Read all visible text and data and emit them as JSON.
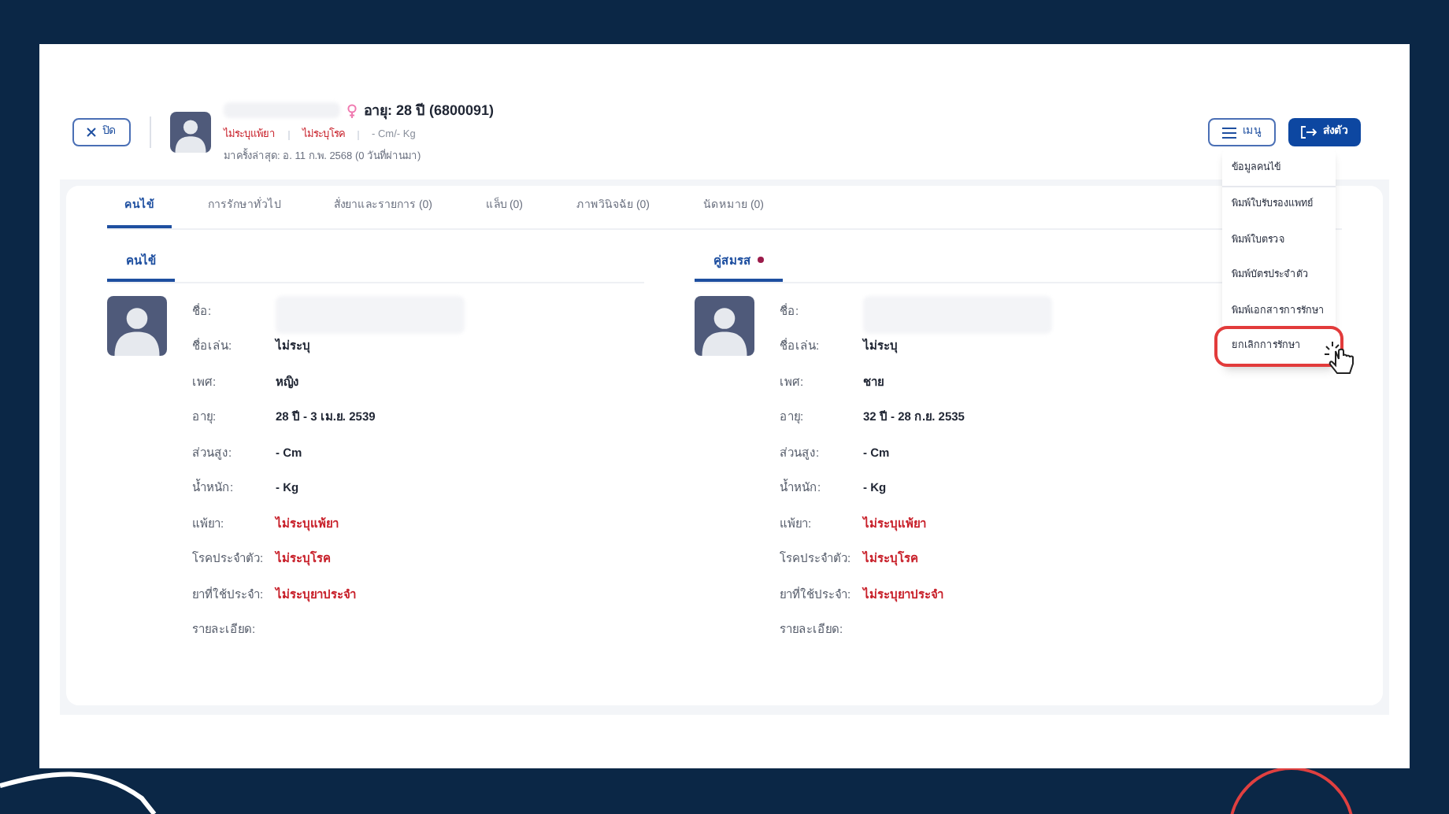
{
  "header": {
    "close_label": "ปิด",
    "age_line": "อายุ: 28 ปี (6800091)",
    "allergy": "ไม่ระบุแพ้ยา",
    "disease": "ไม่ระบุโรค",
    "measure": "- Cm/- Kg",
    "last_visit": "มาครั้งล่าสุด: อ. 11 ก.พ. 2568 (0 วันที่ผ่านมา)",
    "menu_label": "เมนู",
    "refer_label": "ส่งตัว"
  },
  "menu": [
    {
      "label": "ข้อมูลคนไข้",
      "selected": false
    },
    {
      "label": "พิมพ์ใบรับรองแพทย์",
      "selected": false
    },
    {
      "label": "พิมพ์ใบตรวจ",
      "selected": false
    },
    {
      "label": "พิมพ์บัตรประจำตัว",
      "selected": false
    },
    {
      "label": "พิมพ์เอกสารการรักษา",
      "selected": false
    },
    {
      "label": "ยกเลิกการรักษา",
      "selected": true
    }
  ],
  "tabs": [
    {
      "label": "คนไข้",
      "selected": true
    },
    {
      "label": "การรักษาทั่วไป",
      "selected": false
    },
    {
      "label": "สั่งยาและรายการ (0)",
      "selected": false
    },
    {
      "label": "แล็บ (0)",
      "selected": false
    },
    {
      "label": "ภาพวินิจฉัย (0)",
      "selected": false
    },
    {
      "label": "นัดหมาย (0)",
      "selected": false
    }
  ],
  "sections": [
    {
      "title": "คนไข้",
      "indicator": false,
      "fields": [
        {
          "label": "ชื่อ:",
          "kind": "redacted"
        },
        {
          "label": "ชื่อเล่น:",
          "kind": "normal",
          "value": "ไม่ระบุ"
        },
        {
          "label": "เพศ:",
          "kind": "normal",
          "value": "หญิง"
        },
        {
          "label": "อายุ:",
          "kind": "normal",
          "value": "28 ปี - 3 เม.ย. 2539"
        },
        {
          "label": "ส่วนสูง:",
          "kind": "normal",
          "value": "- Cm"
        },
        {
          "label": "น้ำหนัก:",
          "kind": "normal",
          "value": "- Kg"
        },
        {
          "label": "แพ้ยา:",
          "kind": "alert",
          "value": "ไม่ระบุแพ้ยา"
        },
        {
          "label": "โรคประจำตัว:",
          "kind": "alert",
          "value": "ไม่ระบุโรค"
        },
        {
          "label": "ยาที่ใช้ประจำ:",
          "kind": "alert",
          "value": "ไม่ระบุยาประจำ"
        },
        {
          "label": "รายละเอียด:",
          "kind": "normal"
        }
      ]
    },
    {
      "title": "คู่สมรส",
      "indicator": true,
      "fields": [
        {
          "label": "ชื่อ:",
          "kind": "redacted"
        },
        {
          "label": "ชื่อเล่น:",
          "kind": "normal",
          "value": "ไม่ระบุ"
        },
        {
          "label": "เพศ:",
          "kind": "normal",
          "value": "ชาย"
        },
        {
          "label": "อายุ:",
          "kind": "normal",
          "value": "32 ปี - 28 ก.ย. 2535"
        },
        {
          "label": "ส่วนสูง:",
          "kind": "normal",
          "value": "- Cm"
        },
        {
          "label": "น้ำหนัก:",
          "kind": "normal",
          "value": "- Kg"
        },
        {
          "label": "แพ้ยา:",
          "kind": "alert",
          "value": "ไม่ระบุแพ้ยา"
        },
        {
          "label": "โรคประจำตัว:",
          "kind": "alert",
          "value": "ไม่ระบุโรค"
        },
        {
          "label": "ยาที่ใช้ประจำ:",
          "kind": "alert",
          "value": "ไม่ระบุยาประจำ"
        },
        {
          "label": "รายละเอียด:",
          "kind": "normal"
        }
      ]
    }
  ]
}
